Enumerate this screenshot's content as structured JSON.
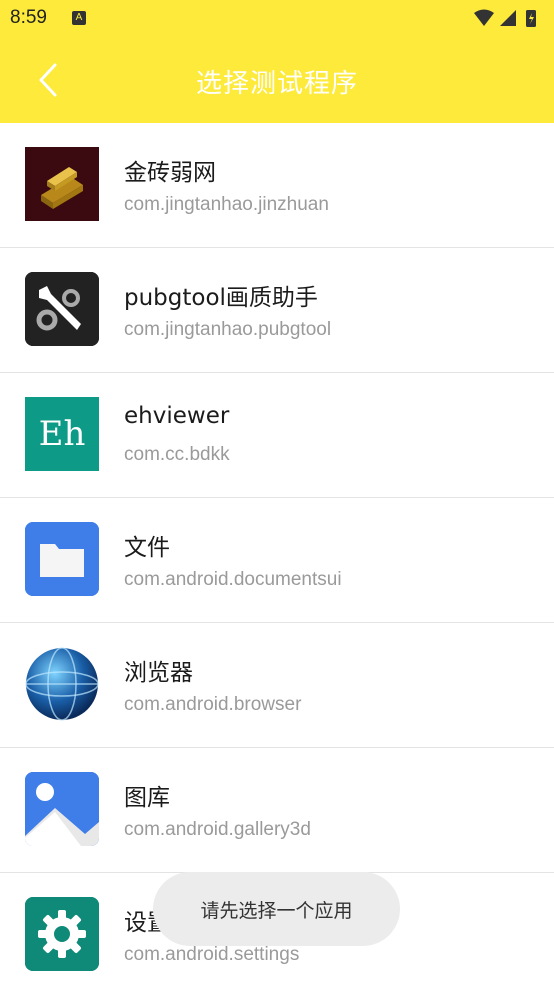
{
  "status_bar": {
    "time": "8:59",
    "notification_letter": "A"
  },
  "app_bar": {
    "title": "选择测试程序"
  },
  "apps": [
    {
      "name": "金砖弱网",
      "package": "com.jingtanhao.jinzhuan",
      "icon": "gold-bar-icon"
    },
    {
      "name": "pubgtool画质助手",
      "package": "com.jingtanhao.pubgtool",
      "icon": "wrench-gear-icon"
    },
    {
      "name": "ehviewer",
      "package": "com.cc.bdkk",
      "icon": "eh-icon",
      "icon_text": "Eh"
    },
    {
      "name": "文件",
      "package": "com.android.documentsui",
      "icon": "folder-icon"
    },
    {
      "name": "浏览器",
      "package": "com.android.browser",
      "icon": "globe-icon"
    },
    {
      "name": "图库",
      "package": "com.android.gallery3d",
      "icon": "gallery-icon"
    },
    {
      "name": "设置",
      "package": "com.android.settings",
      "icon": "settings-gear-icon"
    }
  ],
  "toast": {
    "message": "请先选择一个应用"
  },
  "colors": {
    "accent": "#fdea3a",
    "title": "#ffffff",
    "subtitle": "#9a9a9a"
  }
}
